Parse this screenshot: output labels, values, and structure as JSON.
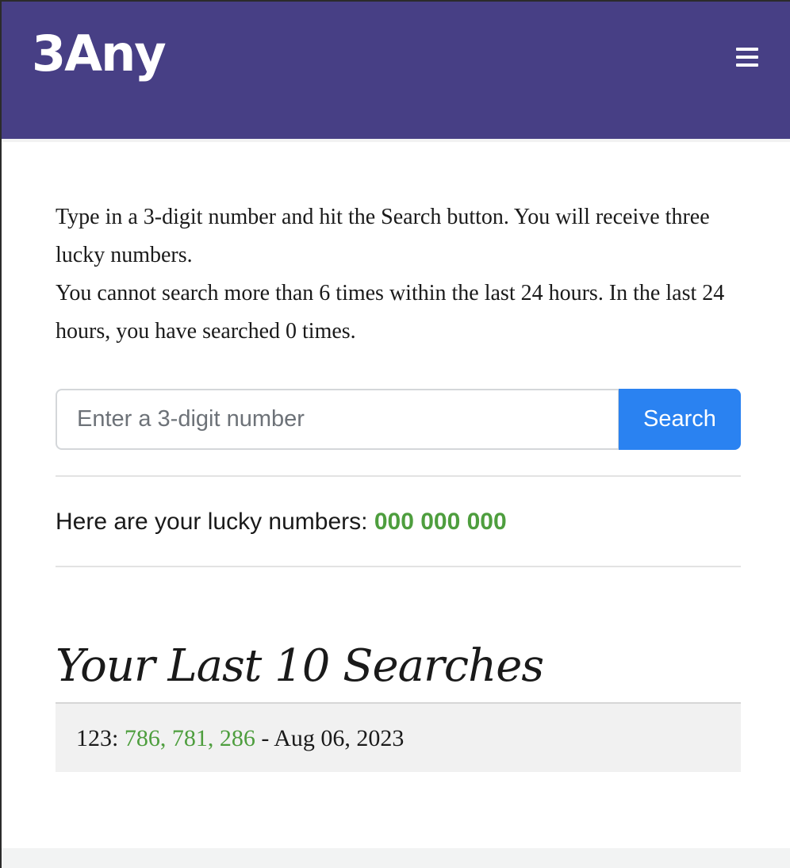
{
  "header": {
    "brand": "3Any",
    "menu_icon": "hamburger-menu-icon",
    "background_color": "#473f85"
  },
  "intro": {
    "line1": "Type in a 3-digit number and hit the Search button. You will receive three lucky numbers.",
    "line2": "You cannot search more than 6 times within the last 24 hours. In the last 24 hours, you have searched 0 times."
  },
  "search": {
    "placeholder": "Enter a 3-digit number",
    "value": "",
    "button_label": "Search",
    "button_color": "#2a82f1"
  },
  "result": {
    "label": "Here are your lucky numbers:",
    "numbers": "000 000 000",
    "accent_color": "#4e9e3e"
  },
  "history": {
    "title": "Your Last 10 Searches",
    "items": [
      {
        "query": "123",
        "results": "786, 781, 286",
        "date": "Aug 06, 2023"
      }
    ]
  }
}
